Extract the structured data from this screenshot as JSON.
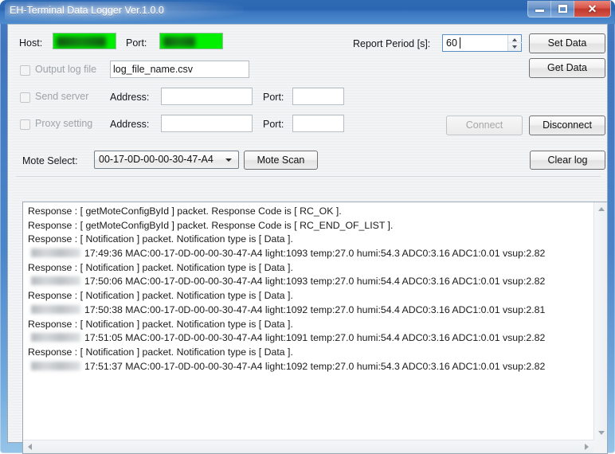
{
  "window": {
    "title": "EH-Terminal Data Logger Ver.1.0.0",
    "minimize_label": "Minimize",
    "maximize_label": "Maximize",
    "close_label": "✕"
  },
  "form": {
    "host_label": "Host:",
    "host_value": "",
    "port_label": "Port:",
    "port_value": "",
    "output_log_label": "Output log file",
    "output_log_checked": false,
    "log_file_value": "log_file_name.csv",
    "send_server_label": "Send server",
    "send_server_checked": false,
    "send_address_label": "Address:",
    "send_address_value": "",
    "send_port_label": "Port:",
    "send_port_value": "",
    "proxy_label": "Proxy setting",
    "proxy_checked": false,
    "proxy_address_label": "Address:",
    "proxy_address_value": "",
    "proxy_port_label": "Port:",
    "proxy_port_value": "",
    "report_period_label": "Report Period [s]:",
    "report_period_value": "60",
    "mote_select_label": "Mote Select:",
    "mote_select_value": "00-17-0D-00-00-30-47-A4"
  },
  "buttons": {
    "set_data": "Set Data",
    "get_data": "Get Data",
    "connect": "Connect",
    "connect_enabled": false,
    "disconnect": "Disconnect",
    "disconnect_enabled": true,
    "mote_scan": "Mote Scan",
    "clear_log": "Clear log"
  },
  "log": {
    "lines": [
      {
        "type": "response",
        "text": "Response : [ getMoteConfigById ] packet. Response Code is [ RC_OK ]."
      },
      {
        "type": "response",
        "text": "Response : [ getMoteConfigById ] packet. Response Code is [ RC_END_OF_LIST ]."
      },
      {
        "type": "response",
        "text": "Response : [ Notification ] packet. Notification type is [ Data ]."
      },
      {
        "type": "data",
        "text": "17:49:36 MAC:00-17-0D-00-00-30-47-A4 light:1093 temp:27.0 humi:54.3 ADC0:3.16 ADC1:0.01 vsup:2.82"
      },
      {
        "type": "response",
        "text": "Response : [ Notification ] packet. Notification type is [ Data ]."
      },
      {
        "type": "data",
        "text": "17:50:06 MAC:00-17-0D-00-00-30-47-A4 light:1093 temp:27.0 humi:54.4 ADC0:3.16 ADC1:0.01 vsup:2.82"
      },
      {
        "type": "response",
        "text": "Response : [ Notification ] packet. Notification type is [ Data ]."
      },
      {
        "type": "data",
        "text": "17:50:38 MAC:00-17-0D-00-00-30-47-A4 light:1092 temp:27.0 humi:54.4 ADC0:3.16 ADC1:0.01 vsup:2.81"
      },
      {
        "type": "response",
        "text": "Response : [ Notification ] packet. Notification type is [ Data ]."
      },
      {
        "type": "data",
        "text": "17:51:05 MAC:00-17-0D-00-00-30-47-A4 light:1091 temp:27.0 humi:54.4 ADC0:3.16 ADC1:0.01 vsup:2.82"
      },
      {
        "type": "response",
        "text": "Response : [ Notification ] packet. Notification type is [ Data ]."
      },
      {
        "type": "data",
        "text": "17:51:37 MAC:00-17-0D-00-00-30-47-A4 light:1092 temp:27.0 humi:54.3 ADC0:3.16 ADC1:0.01 vsup:2.82"
      }
    ]
  },
  "colors": {
    "titlebar_blue": "#2a66b2",
    "frame_blue": "#4a85c9",
    "close_red": "#c0392c",
    "redaction_green": "#00f000",
    "client_bg": "#eef0f2",
    "log_bg": "#ffffff"
  }
}
